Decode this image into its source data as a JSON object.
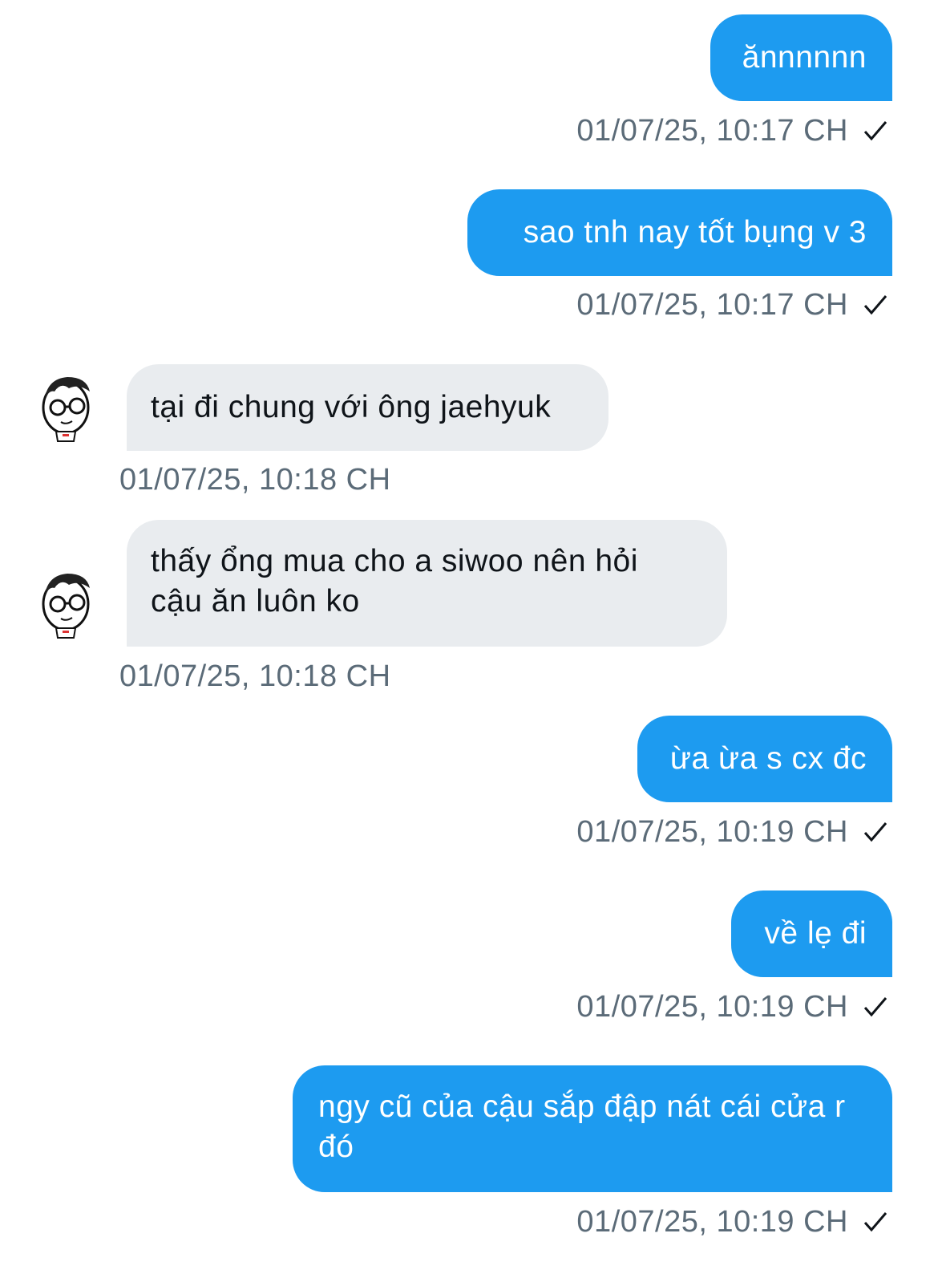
{
  "colors": {
    "outgoing": "#1d9bf0",
    "incoming": "#e9ecef",
    "timestamp": "#5b6b78"
  },
  "messages": [
    {
      "text": "ănnnnnn",
      "time": "01/07/25, 10:17 CH"
    },
    {
      "text": "sao tnh nay tốt bụng v 3",
      "time": "01/07/25, 10:17 CH"
    },
    {
      "text": "tại đi chung với ông jaehyuk",
      "time": "01/07/25, 10:18 CH"
    },
    {
      "text": "thấy ổng mua cho a siwoo nên hỏi cậu ăn luôn ko",
      "time": "01/07/25, 10:18 CH"
    },
    {
      "text": "ừa ừa s cx đc",
      "time": "01/07/25, 10:19 CH"
    },
    {
      "text": "về lẹ đi",
      "time": "01/07/25, 10:19 CH"
    },
    {
      "text": "ngy cũ của cậu sắp đập nát cái cửa r đó",
      "time": "01/07/25, 10:19 CH"
    }
  ]
}
